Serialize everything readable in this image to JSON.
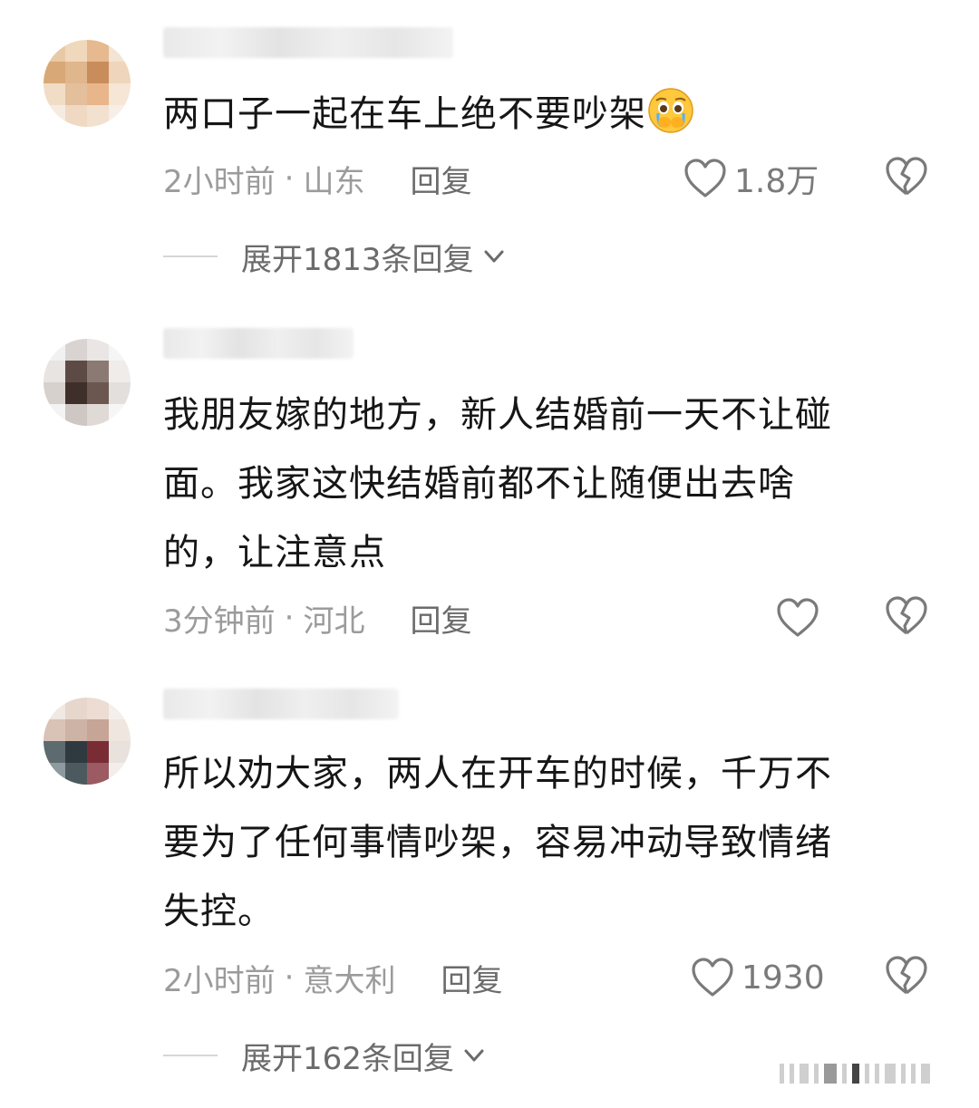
{
  "comments": [
    {
      "text": "两口子一起在车上绝不要吵架",
      "emoji": "crying-pleading-face-emoji",
      "time": "2小时前",
      "location": "山东",
      "reply_label": "回复",
      "like_count": "1.8万",
      "expand_label": "展开1813条回复"
    },
    {
      "text": "我朋友嫁的地方，新人结婚前一天不让碰\n面。我家这快结婚前都不让随便出去啥\n的，让注意点",
      "time": "3分钟前",
      "location": "河北",
      "reply_label": "回复",
      "like_count": ""
    },
    {
      "text": "所以劝大家，两人在开车的时候，千万不\n要为了任何事情吵架，容易冲动导致情绪\n失控。",
      "time": "2小时前",
      "location": "意大利",
      "reply_label": "回复",
      "like_count": "1930",
      "expand_label": "展开162条回复"
    }
  ],
  "separator": "·",
  "colors": {
    "meta_text": "#9b9b9b",
    "action_text": "#6b6b6b",
    "icon_stroke": "#7a7a7a"
  }
}
